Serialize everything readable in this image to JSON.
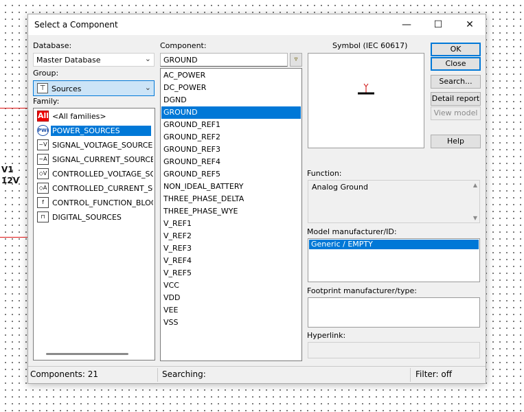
{
  "background": {
    "label_ref": "V1",
    "label_val": "12V"
  },
  "dialog": {
    "title": "Select a Component",
    "window_controls": {
      "minimize": "—",
      "maximize": "☐",
      "close": "✕"
    }
  },
  "database": {
    "label": "Database:",
    "value": "Master Database"
  },
  "group": {
    "label": "Group:",
    "value": "Sources"
  },
  "family": {
    "label": "Family:",
    "items": [
      {
        "icon": "All",
        "label": "<All families>"
      },
      {
        "icon": "PWR",
        "label": "POWER_SOURCES"
      },
      {
        "icon": "~V",
        "label": "SIGNAL_VOLTAGE_SOURCES"
      },
      {
        "icon": "~A",
        "label": "SIGNAL_CURRENT_SOURCES"
      },
      {
        "icon": "◇V",
        "label": "CONTROLLED_VOLTAGE_SOUR"
      },
      {
        "icon": "◇A",
        "label": "CONTROLLED_CURRENT_SOUI"
      },
      {
        "icon": "f",
        "label": "CONTROL_FUNCTION_BLOCKS"
      },
      {
        "icon": "⊓",
        "label": "DIGITAL_SOURCES"
      }
    ],
    "selected_index": 1
  },
  "component": {
    "label": "Component:",
    "filter_value": "GROUND",
    "items": [
      "AC_POWER",
      "DC_POWER",
      "DGND",
      "GROUND",
      "GROUND_REF1",
      "GROUND_REF2",
      "GROUND_REF3",
      "GROUND_REF4",
      "GROUND_REF5",
      "NON_IDEAL_BATTERY",
      "THREE_PHASE_DELTA",
      "THREE_PHASE_WYE",
      "V_REF1",
      "V_REF2",
      "V_REF3",
      "V_REF4",
      "V_REF5",
      "VCC",
      "VDD",
      "VEE",
      "VSS"
    ],
    "selected_index": 3
  },
  "symbol": {
    "label": "Symbol (IEC 60617)"
  },
  "buttons": {
    "ok": "OK",
    "close": "Close",
    "search": "Search...",
    "detail_report": "Detail report",
    "view_model": "View model",
    "help": "Help"
  },
  "function": {
    "label": "Function:",
    "value": "Analog Ground"
  },
  "model": {
    "label": "Model manufacturer/ID:",
    "items": [
      "Generic / EMPTY"
    ],
    "selected_index": 0
  },
  "footprint": {
    "label": "Footprint manufacturer/type:"
  },
  "hyperlink": {
    "label": "Hyperlink:",
    "value": ""
  },
  "status": {
    "components": "Components: 21",
    "searching": "Searching:",
    "filter": "Filter: off"
  },
  "colors": {
    "selection": "#0078d7",
    "accent_red": "#e00000"
  }
}
